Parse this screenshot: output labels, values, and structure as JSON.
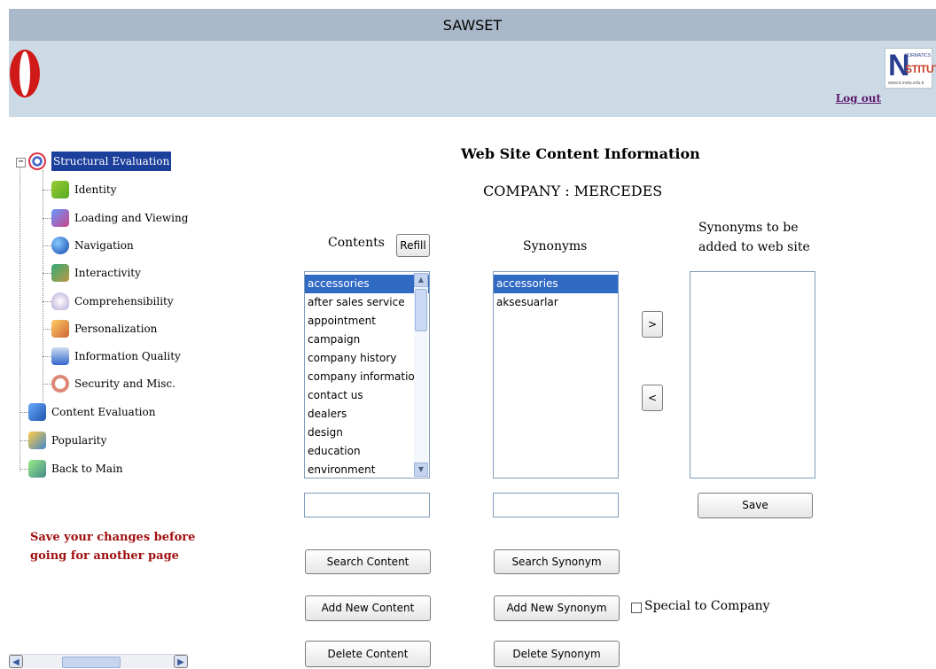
{
  "app": {
    "title": "SAWSET"
  },
  "header": {
    "logout": "Log out"
  },
  "tree": {
    "root": "Structural Evaluation",
    "children": [
      "Identity",
      "Loading and Viewing",
      "Navigation",
      "Interactivity",
      "Comprehensibility",
      "Personalization",
      "Information Quality",
      "Security and Misc."
    ],
    "siblings": [
      "Content Evaluation",
      "Popularity",
      "Back to Main"
    ],
    "expander": "−"
  },
  "warning": "Save your changes before going for another page",
  "main": {
    "title": "Web Site Content Information",
    "company": "COMPANY : MERCEDES",
    "contents_label": "Contents",
    "refill": "Refill",
    "synonyms_label": "Synonyms",
    "to_add_label_1": "Synonyms to be",
    "to_add_label_2": "added to web site",
    "contents": [
      "accessories",
      "after sales service",
      "appointment",
      "campaign",
      "company history",
      "company information",
      "contact us",
      "dealers",
      "design",
      "education",
      "environment"
    ],
    "synonyms": [
      "accessories",
      "aksesuarlar"
    ],
    "move_right": ">",
    "move_left": "<",
    "save": "Save",
    "search_content": "Search Content",
    "search_synonym": "Search Synonym",
    "add_content": "Add New Content",
    "add_synonym": "Add New Synonym",
    "special": "Special to Company",
    "delete_content": "Delete Content",
    "delete_synonym": "Delete Synonym"
  },
  "colors": {
    "title_bar": "#a9b9c9",
    "banner": "#ccdae6",
    "selected": "#316ac5",
    "warning": "#a01010"
  }
}
